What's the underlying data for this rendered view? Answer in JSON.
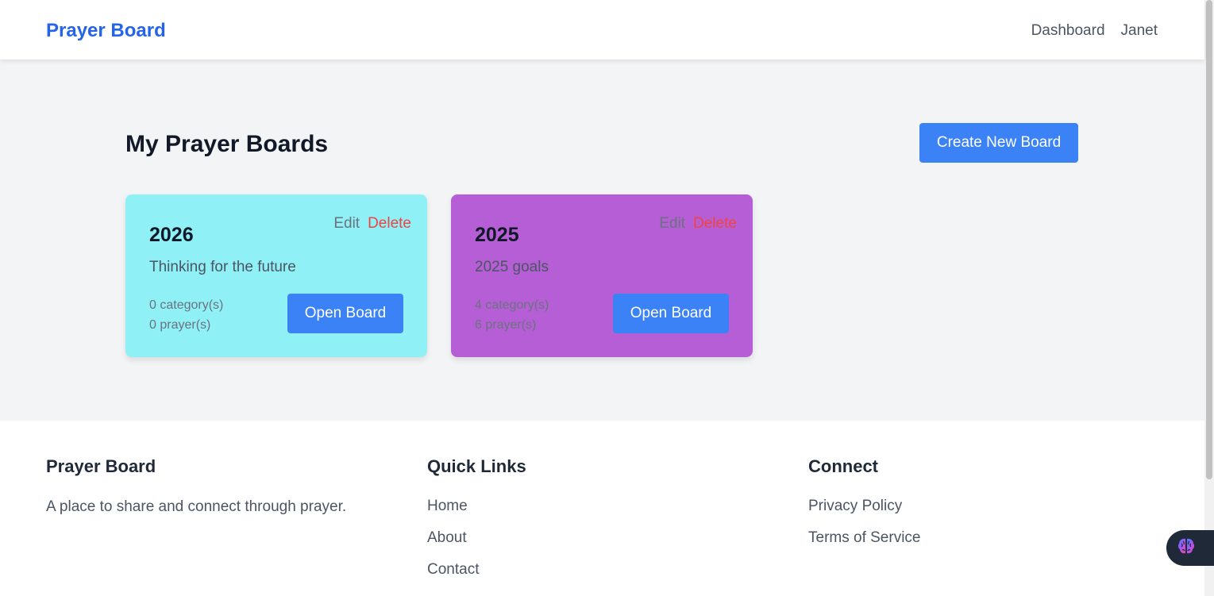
{
  "navbar": {
    "brand": "Prayer Board",
    "links": [
      "Dashboard",
      "Janet"
    ]
  },
  "main": {
    "title": "My Prayer Boards",
    "create_button": "Create New Board",
    "boards": [
      {
        "title": "2026",
        "description": "Thinking for the future",
        "categories": "0 category(s)",
        "prayers": "0 prayer(s)",
        "edit_label": "Edit",
        "delete_label": "Delete",
        "open_label": "Open Board",
        "color": "#8ff0f6"
      },
      {
        "title": "2025",
        "description": "2025 goals",
        "categories": "4 category(s)",
        "prayers": "6 prayer(s)",
        "edit_label": "Edit",
        "delete_label": "Delete",
        "open_label": "Open Board",
        "color": "#b65ed5"
      }
    ]
  },
  "footer": {
    "about": {
      "heading": "Prayer Board",
      "text": "A place to share and connect through prayer."
    },
    "quick_links": {
      "heading": "Quick Links",
      "items": [
        "Home",
        "About",
        "Contact"
      ]
    },
    "connect": {
      "heading": "Connect",
      "items": [
        "Privacy Policy",
        "Terms of Service"
      ]
    }
  },
  "assistant": {
    "icon": "brain-icon"
  },
  "colors": {
    "brand": "#2563eb",
    "primary_button": "#3b82f6",
    "delete": "#ef4444",
    "background": "#f3f4f6"
  }
}
